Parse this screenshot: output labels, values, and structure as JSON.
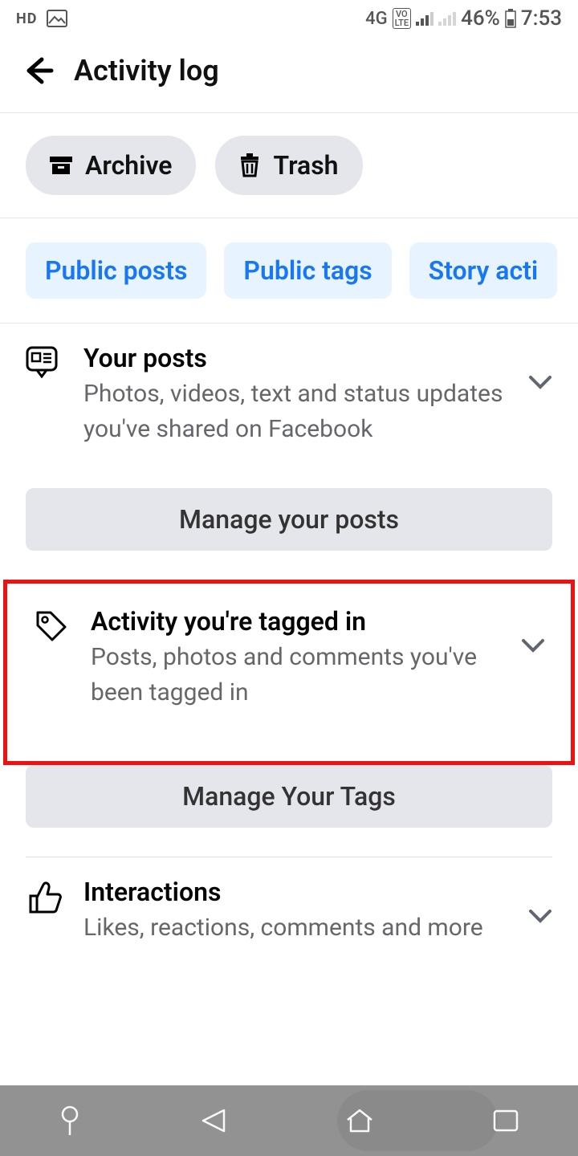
{
  "status": {
    "hd": "HD",
    "network": "4G",
    "volte": "VO\nLTE",
    "battery": "46%",
    "time": "7:53"
  },
  "header": {
    "title": "Activity log"
  },
  "pills": {
    "archive": "Archive",
    "trash": "Trash"
  },
  "tabs": {
    "public_posts": "Public posts",
    "public_tags": "Public tags",
    "story": "Story acti"
  },
  "sections": {
    "your_posts": {
      "title": "Your posts",
      "desc": "Photos, videos, text and status updates you've shared on Facebook",
      "manage": "Manage your posts"
    },
    "tagged": {
      "title": "Activity you're tagged in",
      "desc": "Posts, photos and comments you've been tagged in",
      "manage": "Manage Your Tags"
    },
    "interactions": {
      "title": "Interactions",
      "desc": "Likes, reactions, comments and more"
    }
  }
}
